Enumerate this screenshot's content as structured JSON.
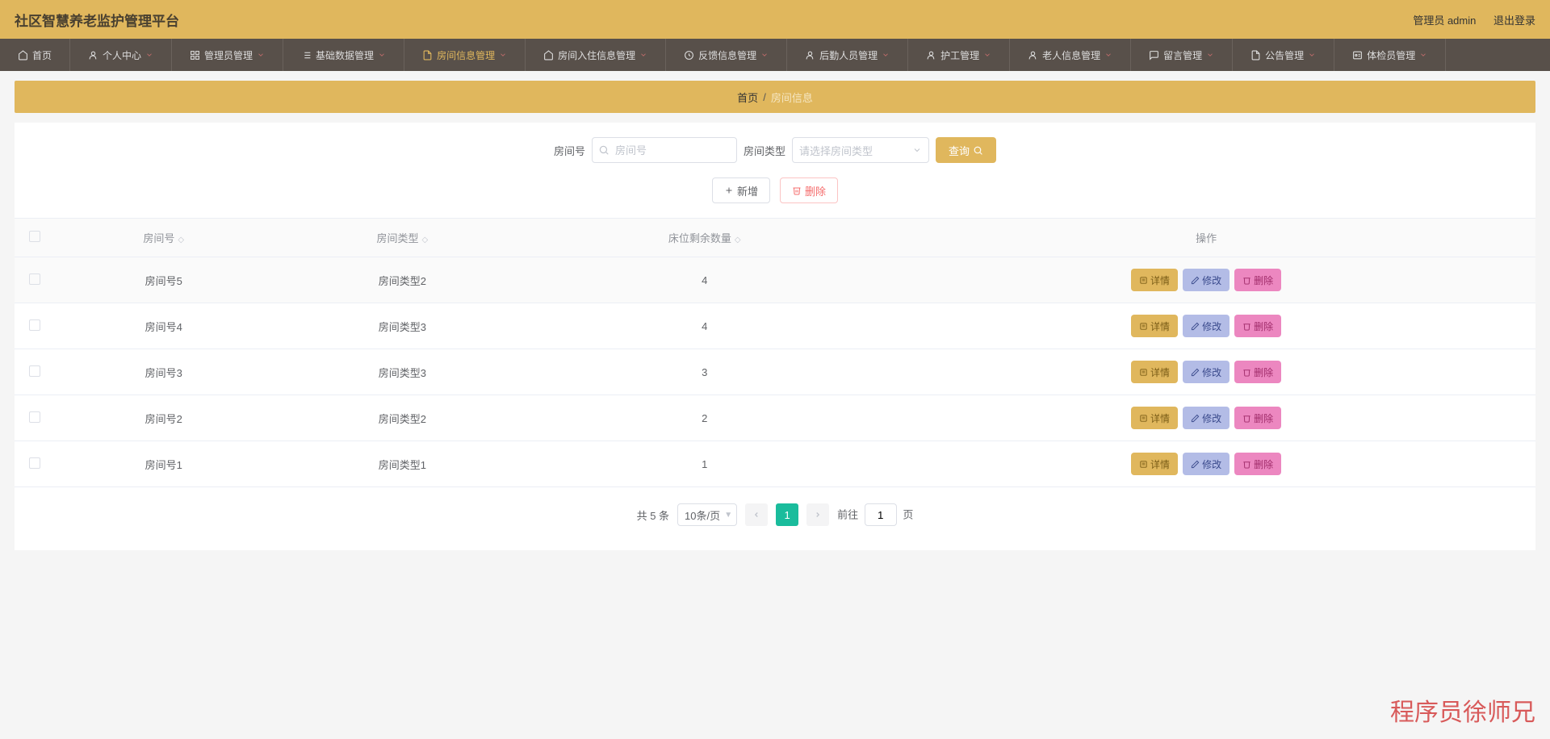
{
  "header": {
    "title": "社区智慧养老监护管理平台",
    "user_label": "管理员 admin",
    "logout": "退出登录"
  },
  "nav": [
    {
      "label": "首页",
      "icon": "home",
      "active": false,
      "caret": false
    },
    {
      "label": "个人中心",
      "icon": "user",
      "active": false,
      "caret": true
    },
    {
      "label": "管理员管理",
      "icon": "grid",
      "active": false,
      "caret": true
    },
    {
      "label": "基础数据管理",
      "icon": "list",
      "active": false,
      "caret": true
    },
    {
      "label": "房间信息管理",
      "icon": "doc",
      "active": true,
      "caret": true
    },
    {
      "label": "房间入住信息管理",
      "icon": "home",
      "active": false,
      "caret": true
    },
    {
      "label": "反馈信息管理",
      "icon": "circle",
      "active": false,
      "caret": true
    },
    {
      "label": "后勤人员管理",
      "icon": "user",
      "active": false,
      "caret": true
    },
    {
      "label": "护工管理",
      "icon": "user",
      "active": false,
      "caret": true
    },
    {
      "label": "老人信息管理",
      "icon": "user",
      "active": false,
      "caret": true
    },
    {
      "label": "留言管理",
      "icon": "msg",
      "active": false,
      "caret": true
    },
    {
      "label": "公告管理",
      "icon": "doc",
      "active": false,
      "caret": true
    },
    {
      "label": "体检员管理",
      "icon": "badge",
      "active": false,
      "caret": true
    }
  ],
  "breadcrumb": {
    "home": "首页",
    "sep": "/",
    "current": "房间信息"
  },
  "search": {
    "room_label": "房间号",
    "room_placeholder": "房间号",
    "type_label": "房间类型",
    "type_placeholder": "请选择房间类型",
    "search_btn": "查询"
  },
  "actions": {
    "add": "新增",
    "delete": "删除"
  },
  "table": {
    "headers": [
      "房间号",
      "房间类型",
      "床位剩余数量",
      "操作"
    ],
    "rows": [
      {
        "room": "房间号5",
        "type": "房间类型2",
        "beds": "4"
      },
      {
        "room": "房间号4",
        "type": "房间类型3",
        "beds": "4"
      },
      {
        "room": "房间号3",
        "type": "房间类型3",
        "beds": "3"
      },
      {
        "room": "房间号2",
        "type": "房间类型2",
        "beds": "2"
      },
      {
        "room": "房间号1",
        "type": "房间类型1",
        "beds": "1"
      }
    ],
    "ops": {
      "view": "详情",
      "edit": "修改",
      "del": "删除"
    }
  },
  "pager": {
    "total": "共 5 条",
    "page_size": "10条/页",
    "current": "1",
    "jump_pre": "前往",
    "jump_val": "1",
    "jump_post": "页"
  },
  "watermark": "程序员徐师兄"
}
